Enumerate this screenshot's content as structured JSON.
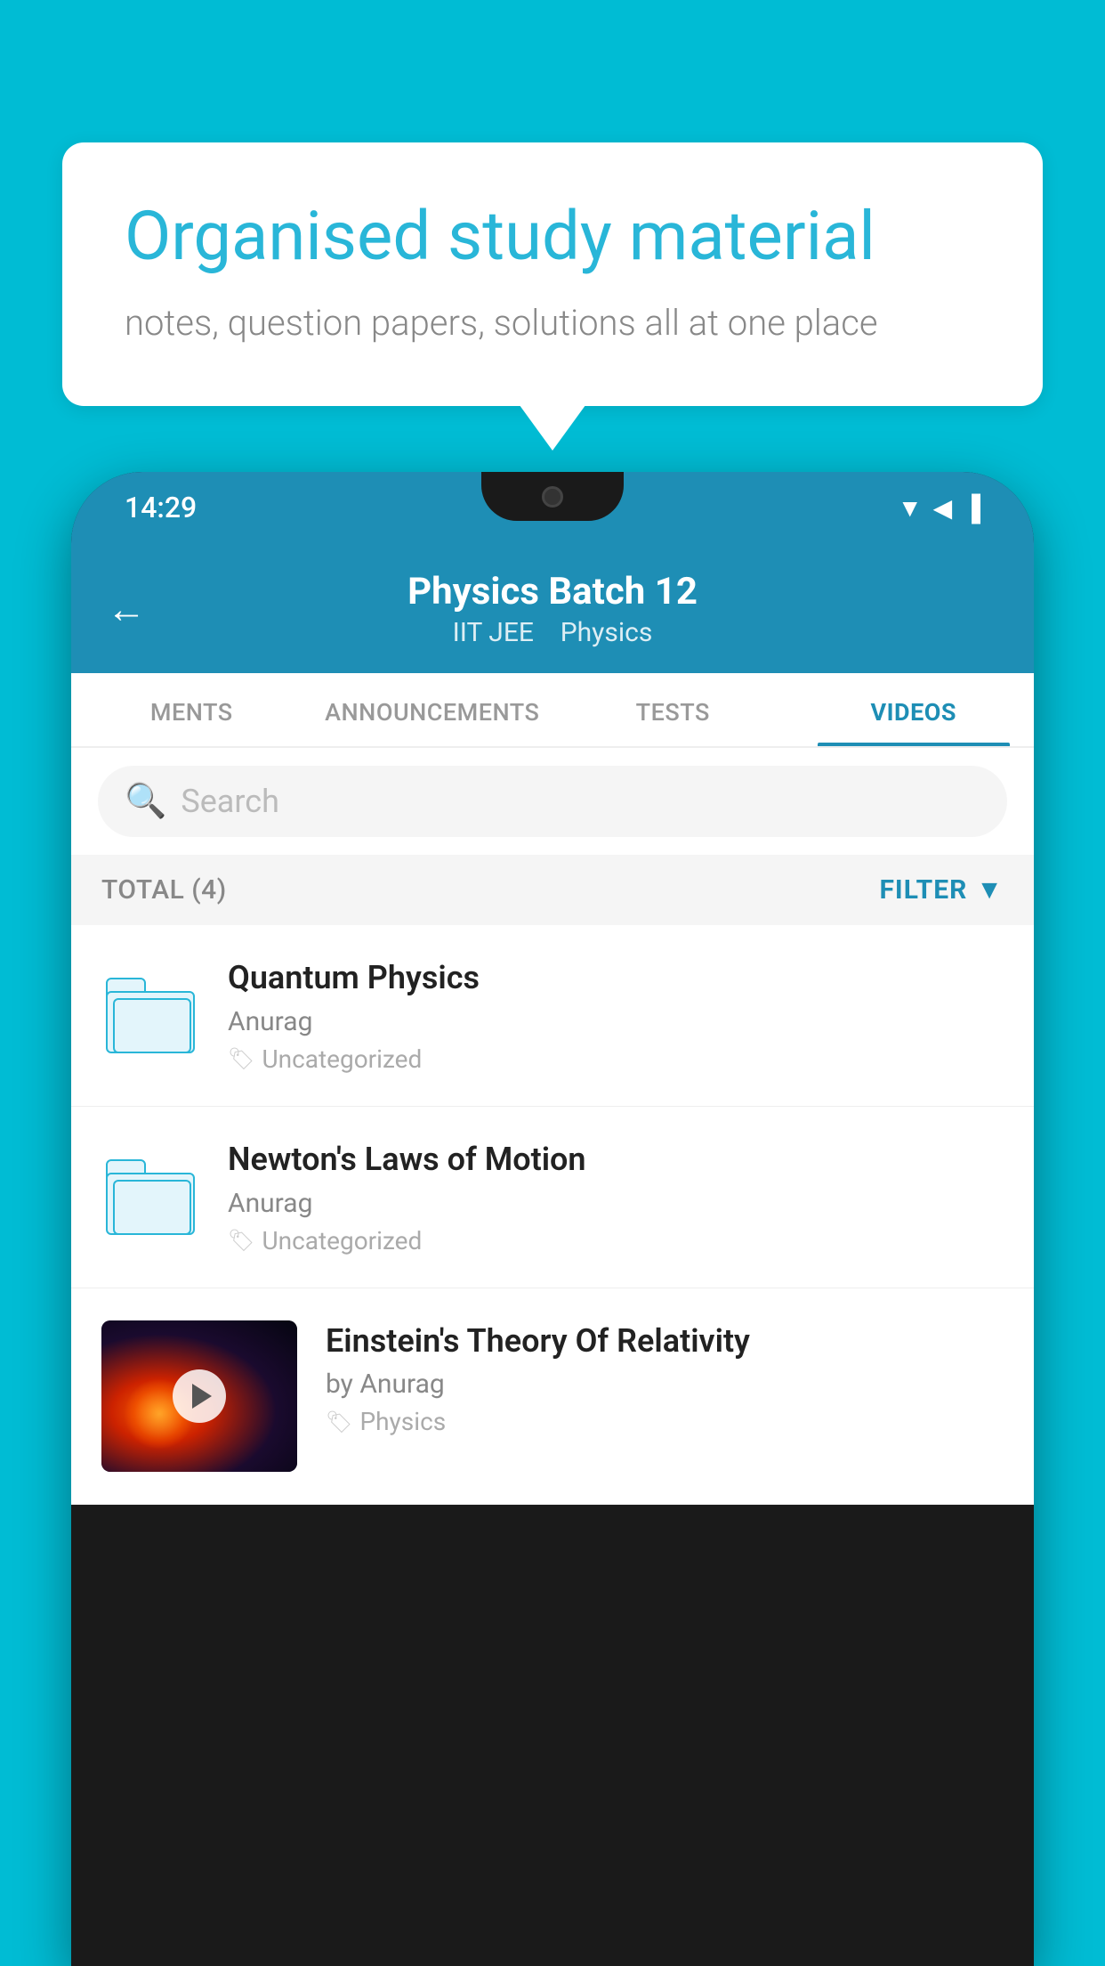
{
  "page": {
    "background_color": "#00bcd4"
  },
  "hero": {
    "title": "Organised study material",
    "subtitle": "notes, question papers, solutions all at one place"
  },
  "phone": {
    "status_bar": {
      "time": "14:29",
      "icons": "▼ ◀ ▌"
    },
    "header": {
      "back_label": "←",
      "title": "Physics Batch 12",
      "subtitle_tag1": "IIT JEE",
      "subtitle_tag2": "Physics"
    },
    "tabs": [
      {
        "label": "MENTS",
        "active": false
      },
      {
        "label": "ANNOUNCEMENTS",
        "active": false
      },
      {
        "label": "TESTS",
        "active": false
      },
      {
        "label": "VIDEOS",
        "active": true
      }
    ],
    "search": {
      "placeholder": "Search"
    },
    "filter_bar": {
      "total_label": "TOTAL (4)",
      "filter_label": "FILTER"
    },
    "videos": [
      {
        "id": 1,
        "title": "Quantum Physics",
        "author": "Anurag",
        "tag": "Uncategorized",
        "type": "folder",
        "has_thumbnail": false
      },
      {
        "id": 2,
        "title": "Newton's Laws of Motion",
        "author": "Anurag",
        "tag": "Uncategorized",
        "type": "folder",
        "has_thumbnail": false
      },
      {
        "id": 3,
        "title": "Einstein's Theory Of Relativity",
        "author": "by Anurag",
        "tag": "Physics",
        "type": "video",
        "has_thumbnail": true
      }
    ]
  }
}
